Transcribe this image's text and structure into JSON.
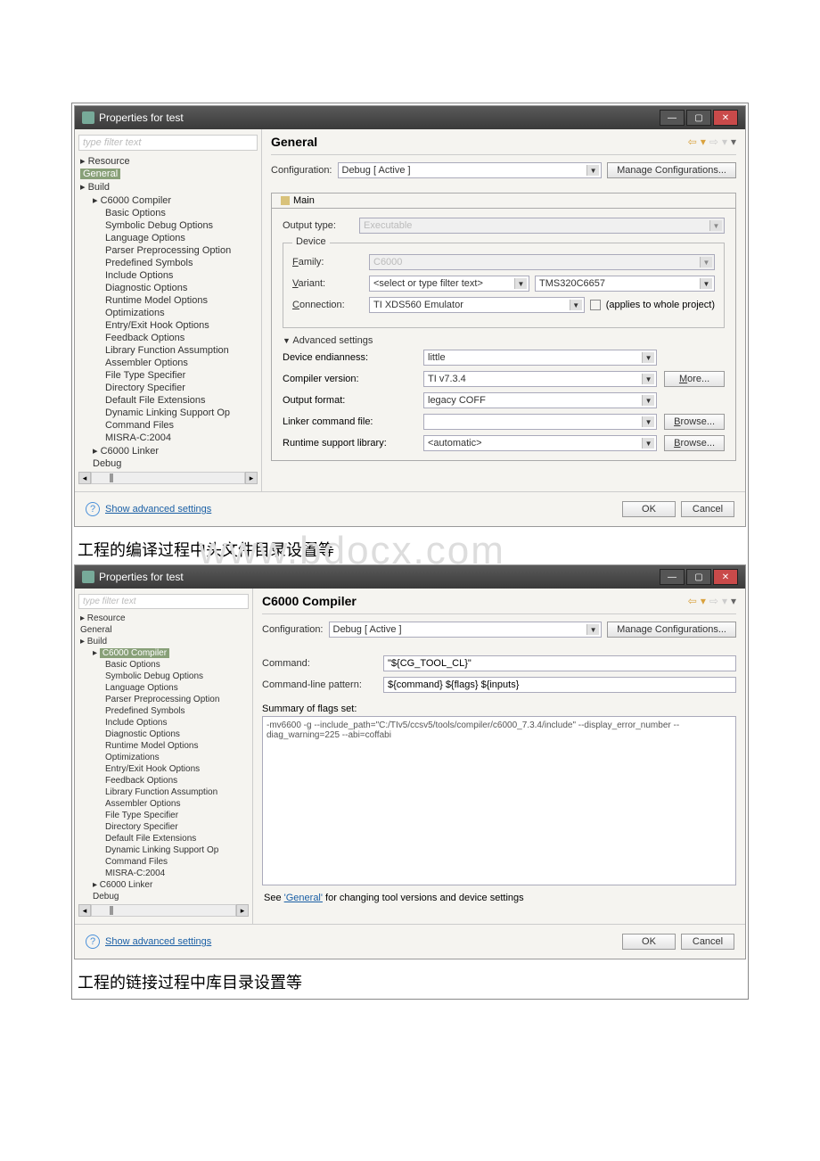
{
  "win1": {
    "title": "Properties for test",
    "filter_placeholder": "type filter text",
    "tree": [
      {
        "label": "Resource",
        "lvl": 1,
        "hasChildren": true
      },
      {
        "label": "General",
        "lvl": 1,
        "sel": true
      },
      {
        "label": "Build",
        "lvl": 1,
        "hasChildren": true
      },
      {
        "label": "C6000 Compiler",
        "lvl": 2,
        "hasChildren": true
      },
      {
        "label": "Basic Options",
        "lvl": 3
      },
      {
        "label": "Symbolic Debug Options",
        "lvl": 3
      },
      {
        "label": "Language Options",
        "lvl": 3
      },
      {
        "label": "Parser Preprocessing Option",
        "lvl": 3
      },
      {
        "label": "Predefined Symbols",
        "lvl": 3
      },
      {
        "label": "Include Options",
        "lvl": 3
      },
      {
        "label": "Diagnostic Options",
        "lvl": 3
      },
      {
        "label": "Runtime Model Options",
        "lvl": 3
      },
      {
        "label": "Optimizations",
        "lvl": 3
      },
      {
        "label": "Entry/Exit Hook Options",
        "lvl": 3
      },
      {
        "label": "Feedback Options",
        "lvl": 3
      },
      {
        "label": "Library Function Assumption",
        "lvl": 3
      },
      {
        "label": "Assembler Options",
        "lvl": 3
      },
      {
        "label": "File Type Specifier",
        "lvl": 3
      },
      {
        "label": "Directory Specifier",
        "lvl": 3
      },
      {
        "label": "Default File Extensions",
        "lvl": 3
      },
      {
        "label": "Dynamic Linking Support Op",
        "lvl": 3
      },
      {
        "label": "Command Files",
        "lvl": 3
      },
      {
        "label": "MISRA-C:2004",
        "lvl": 3
      },
      {
        "label": "C6000 Linker",
        "lvl": 2,
        "hasChildren": true
      },
      {
        "label": "Debug",
        "lvl": 2
      }
    ],
    "heading": "General",
    "config_label": "Configuration:",
    "config_value": "Debug [ Active ]",
    "manage_btn": "Manage Configurations...",
    "tab_main": "Main",
    "output_type_label": "Output type:",
    "output_type_value": "Executable",
    "device_legend": "Device",
    "family_label": "Family:",
    "family_value": "C6000",
    "variant_label": "Variant:",
    "variant_value": "<select or type filter text>",
    "variant_second": "TMS320C6657",
    "connection_label": "Connection:",
    "connection_value": "TI XDS560 Emulator",
    "applies_label": "(applies to whole project)",
    "adv_toggle": "Advanced settings",
    "endianness_label": "Device endianness:",
    "endianness_value": "little",
    "compiler_ver_label": "Compiler version:",
    "compiler_ver_value": "TI v7.3.4",
    "more_btn": "More...",
    "output_fmt_label": "Output format:",
    "output_fmt_value": "legacy COFF",
    "linker_cmd_label": "Linker command file:",
    "browse_btn": "Browse...",
    "runtime_lib_label": "Runtime support library:",
    "runtime_lib_value": "<automatic>",
    "show_adv": "Show advanced settings",
    "ok": "OK",
    "cancel": "Cancel"
  },
  "caption1": "工程的编译过程中头文件目录设置等",
  "watermark": "www.bdocx.com",
  "win2": {
    "title": "Properties for test",
    "filter_placeholder": "type filter text",
    "tree": [
      {
        "label": "Resource",
        "lvl": 1,
        "hasChildren": true
      },
      {
        "label": "General",
        "lvl": 1
      },
      {
        "label": "Build",
        "lvl": 1,
        "hasChildren": true
      },
      {
        "label": "C6000 Compiler",
        "lvl": 2,
        "hasChildren": true,
        "sel": true
      },
      {
        "label": "Basic Options",
        "lvl": 3
      },
      {
        "label": "Symbolic Debug Options",
        "lvl": 3
      },
      {
        "label": "Language Options",
        "lvl": 3
      },
      {
        "label": "Parser Preprocessing Option",
        "lvl": 3
      },
      {
        "label": "Predefined Symbols",
        "lvl": 3
      },
      {
        "label": "Include Options",
        "lvl": 3
      },
      {
        "label": "Diagnostic Options",
        "lvl": 3
      },
      {
        "label": "Runtime Model Options",
        "lvl": 3
      },
      {
        "label": "Optimizations",
        "lvl": 3
      },
      {
        "label": "Entry/Exit Hook Options",
        "lvl": 3
      },
      {
        "label": "Feedback Options",
        "lvl": 3
      },
      {
        "label": "Library Function Assumption",
        "lvl": 3
      },
      {
        "label": "Assembler Options",
        "lvl": 3
      },
      {
        "label": "File Type Specifier",
        "lvl": 3
      },
      {
        "label": "Directory Specifier",
        "lvl": 3
      },
      {
        "label": "Default File Extensions",
        "lvl": 3
      },
      {
        "label": "Dynamic Linking Support Op",
        "lvl": 3
      },
      {
        "label": "Command Files",
        "lvl": 3
      },
      {
        "label": "MISRA-C:2004",
        "lvl": 3
      },
      {
        "label": "C6000 Linker",
        "lvl": 2,
        "hasChildren": true
      },
      {
        "label": "Debug",
        "lvl": 2
      }
    ],
    "heading": "C6000 Compiler",
    "config_label": "Configuration:",
    "config_value": "Debug [ Active ]",
    "manage_btn": "Manage Configurations...",
    "command_label": "Command:",
    "command_value": "\"${CG_TOOL_CL}\"",
    "cmdpattern_label": "Command-line pattern:",
    "cmdpattern_value": "${command} ${flags} ${inputs}",
    "summary_label": "Summary of flags set:",
    "summary_value": "-mv6600 -g --include_path=\"C:/TIv5/ccsv5/tools/compiler/c6000_7.3.4/include\" --display_error_number --diag_warning=225 --abi=coffabi",
    "seelink_pre": "See ",
    "seelink": "'General'",
    "seelink_post": " for changing tool versions and device settings",
    "show_adv": "Show advanced settings",
    "ok": "OK",
    "cancel": "Cancel"
  },
  "caption2": "工程的链接过程中库目录设置等"
}
